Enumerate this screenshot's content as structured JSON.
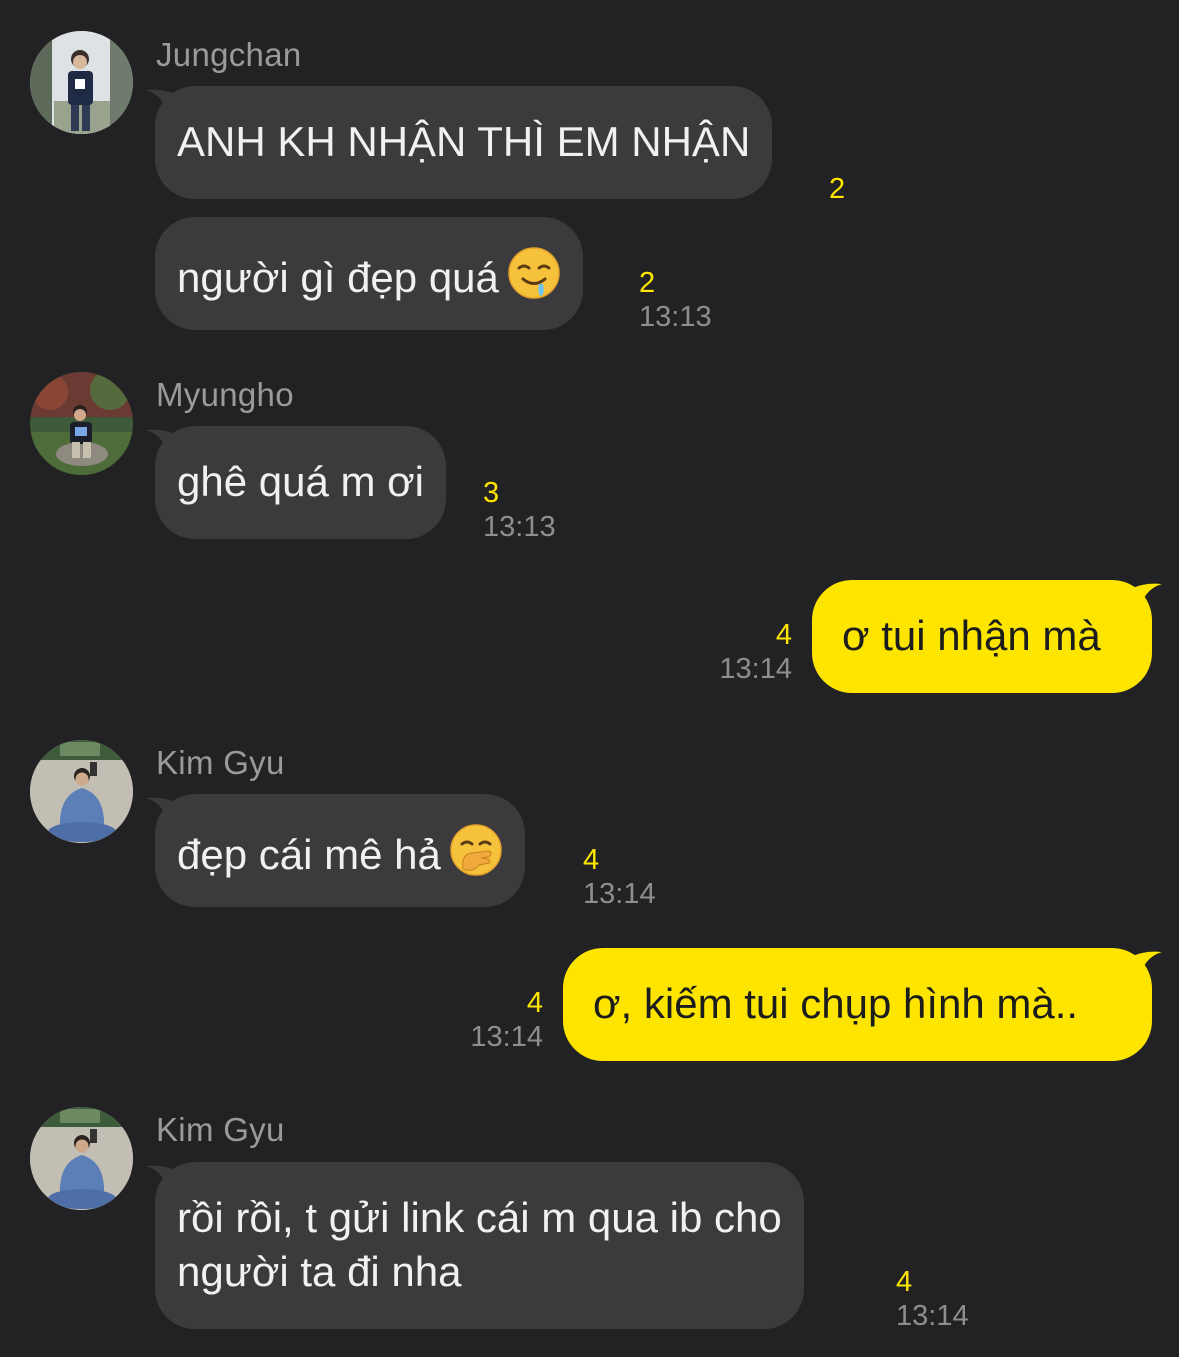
{
  "messages": [
    {
      "sender": "Jungchan",
      "text": "ANH KH NHẬN THÌ EM NHẬN",
      "unread": "2"
    },
    {
      "text": "người gì đẹp quá",
      "emoji_icon": "drooling-face-emoji",
      "unread": "2",
      "time": "13:13"
    },
    {
      "sender": "Myungho",
      "text": "ghê quá m ơi",
      "unread": "3",
      "time": "13:13"
    },
    {
      "text": "ơ tui nhận mà",
      "unread": "4",
      "time": "13:14",
      "mine": true
    },
    {
      "sender": "Kim Gyu",
      "text": "đẹp cái mê hả",
      "emoji_icon": "face-with-hand-over-mouth-emoji",
      "unread": "4",
      "time": "13:14"
    },
    {
      "text": "ơ, kiếm tui chụp hình mà..",
      "unread": "4",
      "time": "13:14",
      "mine": true
    },
    {
      "sender": "Kim Gyu",
      "text_line1": "rồi rồi, t gửi link cái m qua ib cho",
      "text_line2": "người ta đi nha",
      "unread": "4",
      "time": "13:14"
    }
  ],
  "colors": {
    "background": "#222224",
    "incoming_bubble": "#3b3b3e",
    "outgoing_bubble": "#fde500",
    "unread_count": "#fde500",
    "timestamp": "#8e8e90",
    "sender_name": "#9a9a9c"
  }
}
